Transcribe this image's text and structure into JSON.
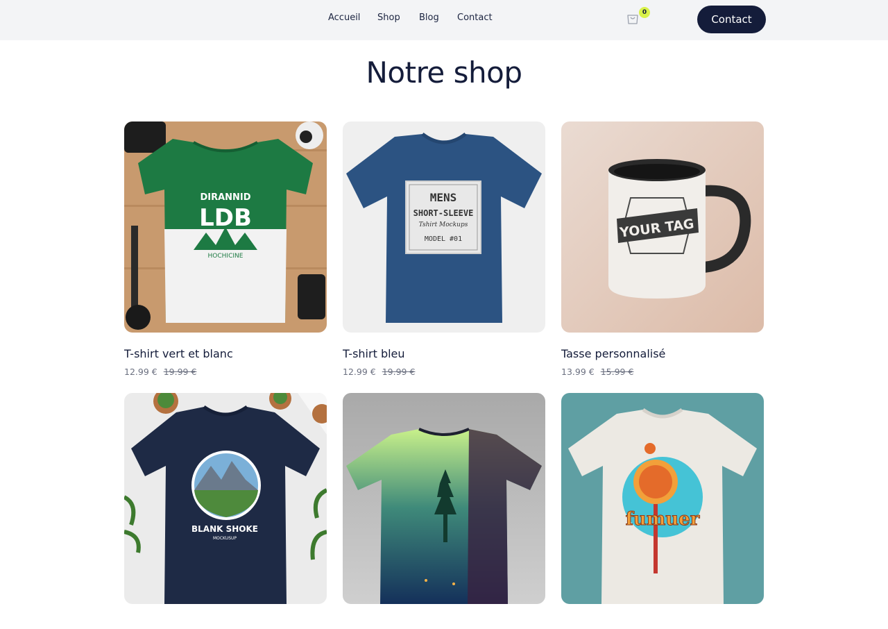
{
  "nav": {
    "items": [
      {
        "label": "Accueil"
      },
      {
        "label": "Shop"
      },
      {
        "label": "Blog"
      },
      {
        "label": "Contact"
      }
    ],
    "cart_count": "0",
    "contact_button": "Contact"
  },
  "page_title": "Notre shop",
  "products": [
    {
      "name": "T-shirt vert et blanc",
      "price": "12.99 €",
      "old_price": "19.99 €"
    },
    {
      "name": "T-shirt bleu",
      "price": "12.99 €",
      "old_price": "19.99 €"
    },
    {
      "name": "Tasse personnalisé",
      "price": "13.99 €",
      "old_price": "15.99 €"
    },
    {
      "name": "",
      "price": "",
      "old_price": ""
    },
    {
      "name": "",
      "price": "",
      "old_price": ""
    },
    {
      "name": "",
      "price": "",
      "old_price": ""
    }
  ],
  "image_text": {
    "p1_line1": "DIRANNID",
    "p1_line2": "LDB",
    "p1_line3": "HOCHICINE",
    "p2_line1": "MENS",
    "p2_line2": "SHORT-SLEEVE",
    "p2_line3": "Tshirt Mockups",
    "p2_line4": "MODEL #01",
    "p3_line1": "YOUR TAG",
    "p4_line1": "BLANK SHOKE",
    "p4_line2": "MOCKUSUP",
    "p6_line1": "fumuer"
  },
  "colors": {
    "navy": "#141c3a",
    "accent_badge": "#d9f24a",
    "topbar": "#f3f4f6"
  }
}
